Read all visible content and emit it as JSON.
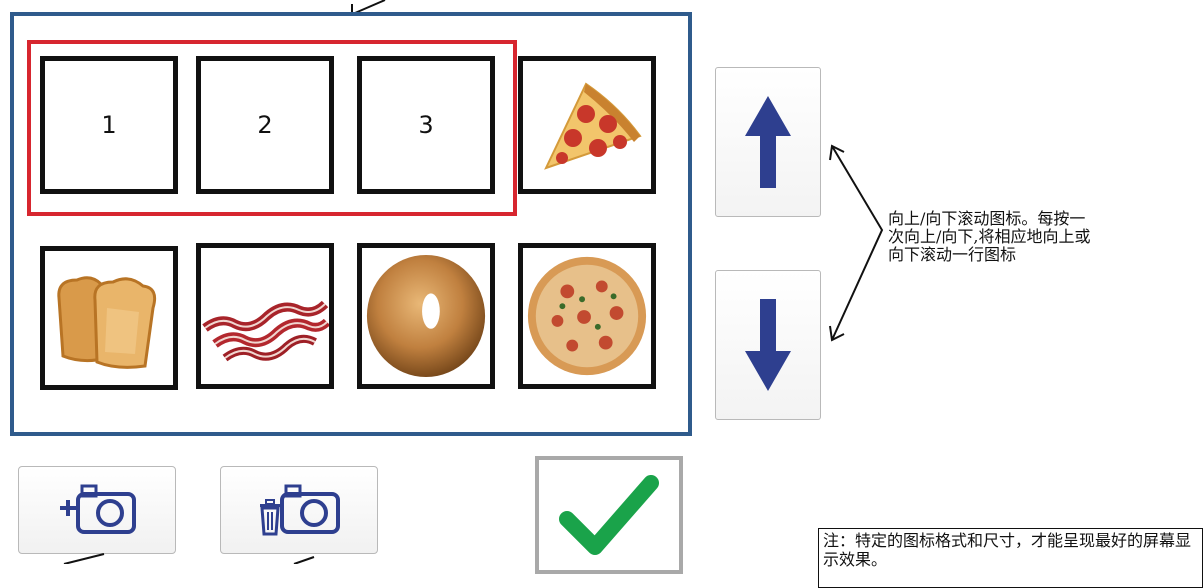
{
  "tiles": {
    "row1": [
      "1",
      "2",
      "3"
    ],
    "pizza_slice_icon": "pizza-slice-icon",
    "row2_icons": [
      "toast-icon",
      "bacon-icon",
      "bagel-icon",
      "pizza-icon"
    ]
  },
  "scroll": {
    "annotation_lines": [
      "向上/向下滚动图标。每按一",
      "次向上/向下,将相应地向上或",
      "向下滚动一行图标"
    ]
  },
  "bottom": {
    "add_photo_icon": "add-photo-icon",
    "delete_photo_icon": "delete-photo-icon",
    "confirm_icon": "checkmark-icon"
  },
  "note": {
    "text": "注：特定的图标格式和尺寸，才能呈现最好的屏幕显示效果。"
  },
  "colors": {
    "panel_border": "#2f5b8c",
    "selection_border": "#d7262f",
    "arrow_blue": "#2e3f8f",
    "check_green": "#1aa34a"
  }
}
